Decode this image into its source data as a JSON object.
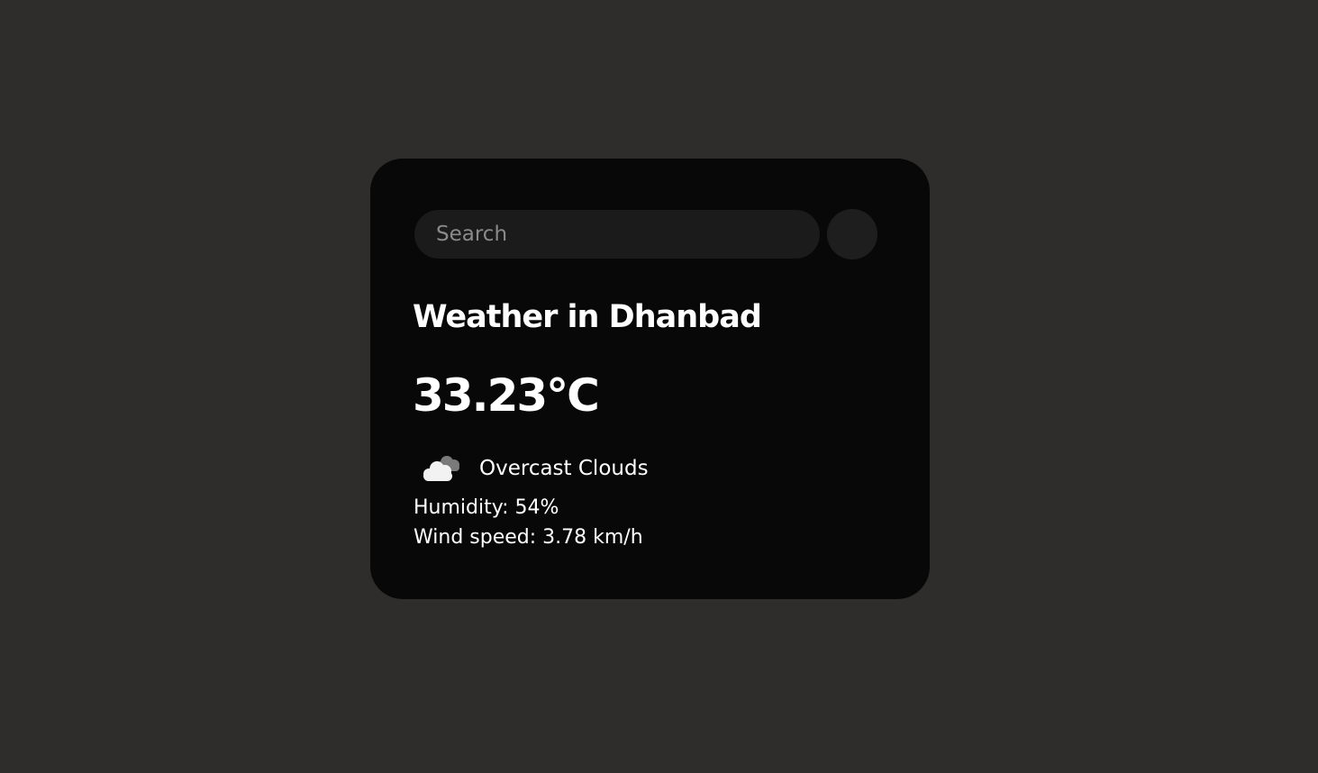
{
  "search": {
    "placeholder": "Search",
    "value": ""
  },
  "weather": {
    "city_heading": "Weather in Dhanbad",
    "temperature": "33.23°C",
    "description": "Overcast Clouds",
    "icon": "overcast-clouds-icon",
    "humidity": "Humidity: 54%",
    "wind_speed": "Wind speed: 3.78 km/h"
  },
  "colors": {
    "page_background": "#2e2d2c",
    "card_background": "#080808",
    "input_background": "#1b1b1b",
    "button_background": "#1e1e1e",
    "text": "#ffffff",
    "placeholder_text": "#8a8a8a"
  }
}
